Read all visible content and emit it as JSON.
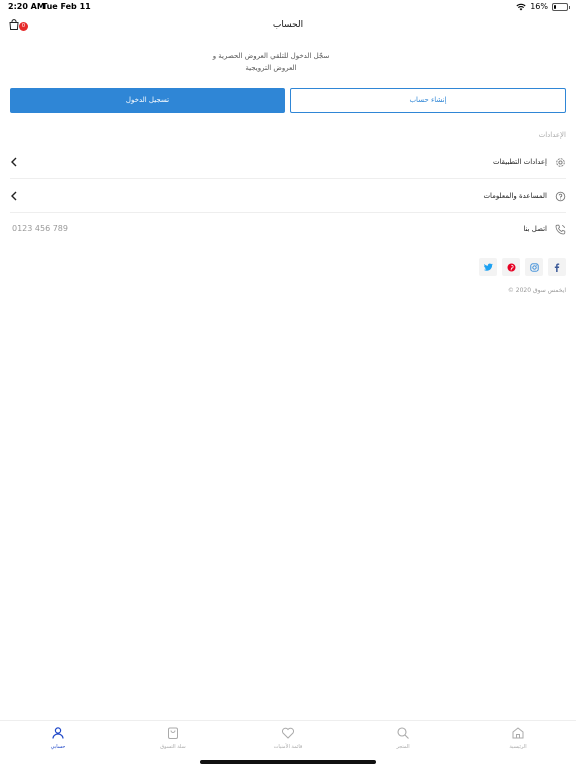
{
  "status_bar": {
    "time": "2:20 AM",
    "date": "Tue Feb 11",
    "battery_text": "16%",
    "battery_level": 0.16
  },
  "header": {
    "title": "الحساب",
    "cart_count": "0"
  },
  "intro": {
    "line1": "سجّل الدخول للتلقي العروض الحصرية و",
    "line2": "العروض الترويجية"
  },
  "buttons": {
    "login": "تسجيل الدخول",
    "signup": "إنشاء حساب"
  },
  "settings": {
    "section_label": "الإعدادات",
    "items": [
      {
        "label": "إعدادات التطبيقات",
        "icon": "gear-icon"
      },
      {
        "label": "المساعدة والمعلومات",
        "icon": "help-icon"
      },
      {
        "label": "اتصل بنا",
        "icon": "phone-icon",
        "value": "0123 456 789"
      }
    ]
  },
  "socials": [
    {
      "name": "facebook",
      "icon": "facebook-icon",
      "color": "#3b5998"
    },
    {
      "name": "instagram",
      "icon": "instagram-icon",
      "color": "#2f86d6"
    },
    {
      "name": "pinterest",
      "icon": "pinterest-icon",
      "color": "#e60023"
    },
    {
      "name": "twitter",
      "icon": "twitter-icon",
      "color": "#1da1f2"
    }
  ],
  "copyright": "© 2020 ايخمس سوق",
  "tabs": [
    {
      "label": "الرئيسية",
      "icon": "home-icon",
      "active": false
    },
    {
      "label": "المتجر",
      "icon": "search-icon",
      "active": false
    },
    {
      "label": "قائمة الأمنيات",
      "icon": "heart-icon",
      "active": false
    },
    {
      "label": "سلة التسوق",
      "icon": "bag-icon",
      "active": false
    },
    {
      "label": "حسابي",
      "icon": "user-icon",
      "active": true
    }
  ],
  "colors": {
    "accent": "#2f86d6",
    "active_tab": "#1e47c8",
    "badge": "#e62b2b"
  }
}
